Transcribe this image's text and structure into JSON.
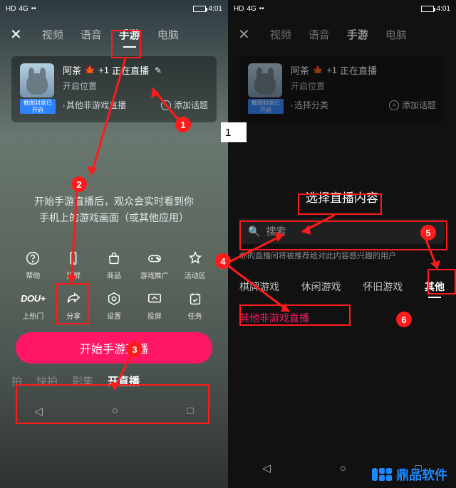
{
  "status": {
    "hd": "HD",
    "net": "4G",
    "time": "4:01"
  },
  "tabs": [
    "视频",
    "语音",
    "手游",
    "电脑"
  ],
  "close_icon": "✕",
  "profile": {
    "avatar_caption": "截图封面已开启",
    "name": "阿茶",
    "leaf": "🍁",
    "plus1": "+1",
    "live_status": "正在直播",
    "edit_icon": "✎",
    "sub": "开启位置",
    "category_left": "其他非游戏直播",
    "category_right": "选择分类",
    "add_topic": "添加话题"
  },
  "hint_line1": "开始手游直播后，观众会实时看到你",
  "hint_line2": "手机上的游戏画面（或其他应用）",
  "icons_row1": [
    {
      "name": "help-icon",
      "label": "帮助"
    },
    {
      "name": "portrait-icon",
      "label": "竖屏"
    },
    {
      "name": "shop-icon",
      "label": "商品"
    },
    {
      "name": "gamepad-icon",
      "label": "游戏推广"
    },
    {
      "name": "star-icon",
      "label": "活动区"
    }
  ],
  "icons_row2": [
    {
      "name": "dou-icon",
      "label": "上热门",
      "text": "DOU+"
    },
    {
      "name": "share-icon",
      "label": "分享"
    },
    {
      "name": "settings-icon",
      "label": "设置"
    },
    {
      "name": "cast-icon",
      "label": "投屏"
    },
    {
      "name": "tasks-icon",
      "label": "任务"
    }
  ],
  "start_button": "开始手游直播",
  "bottom_tabs": [
    "拍",
    "快拍",
    "影集",
    "开直播"
  ],
  "panel": {
    "title": "选择直播内容",
    "search_placeholder": "搜索",
    "search_hint": "你的直播间将被推荐给对此内容感兴趣的用户",
    "categories": [
      "棋牌游戏",
      "休闲游戏",
      "怀旧游戏",
      "其他"
    ],
    "sub_category": "其他非游戏直播"
  },
  "annotations": {
    "c1": "1",
    "c2": "2",
    "c3": "3",
    "c4": "4",
    "c5": "5",
    "c6": "6",
    "input_value": "1"
  },
  "watermark": "鼎品软件"
}
